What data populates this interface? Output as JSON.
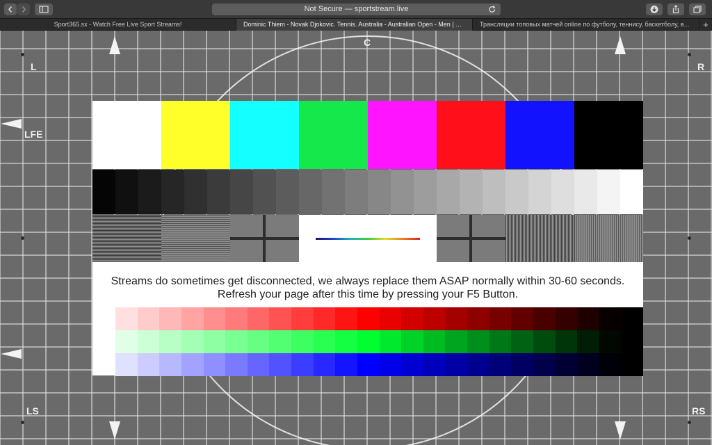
{
  "browser": {
    "address": "Not Secure — sportstream.live",
    "tabs": [
      {
        "title": "Sport365.sx - Watch Free Live Sport Streams!"
      },
      {
        "title": "Dominic Thiem - Novak Djokovic. Tennis. Australia - Australian Open - Men | SportSt..."
      },
      {
        "title": "Трансляции топовых матчей online по футболу, теннису, баскетболу, волейбо..."
      }
    ],
    "new_tab": "+",
    "icons": [
      "back-icon",
      "forward-icon",
      "sidebar-icon",
      "reload-icon",
      "download-icon",
      "share-icon",
      "tabs-overview-icon"
    ]
  },
  "testcard": {
    "labels": {
      "left": "L",
      "center": "C",
      "right": "R",
      "lfe": "LFE",
      "left_surround": "LS",
      "right_surround": "RS"
    },
    "message_line1": "Streams do sometimes get disconnected, we always replace them ASAP normally within 30-60 seconds.",
    "message_line2": "Refresh your page after this time by pressing your F5 Button.",
    "color_bars": [
      "#ffffff",
      "#ffff2a",
      "#14ffff",
      "#14e84a",
      "#ff14ff",
      "#ff0f1a",
      "#1212ff",
      "#000000"
    ],
    "gray_steps": 24,
    "ramp_colors": {
      "red": "#ff0000",
      "green": "#00ff30",
      "blue": "#0000ff"
    },
    "ramp_steps": 23
  }
}
